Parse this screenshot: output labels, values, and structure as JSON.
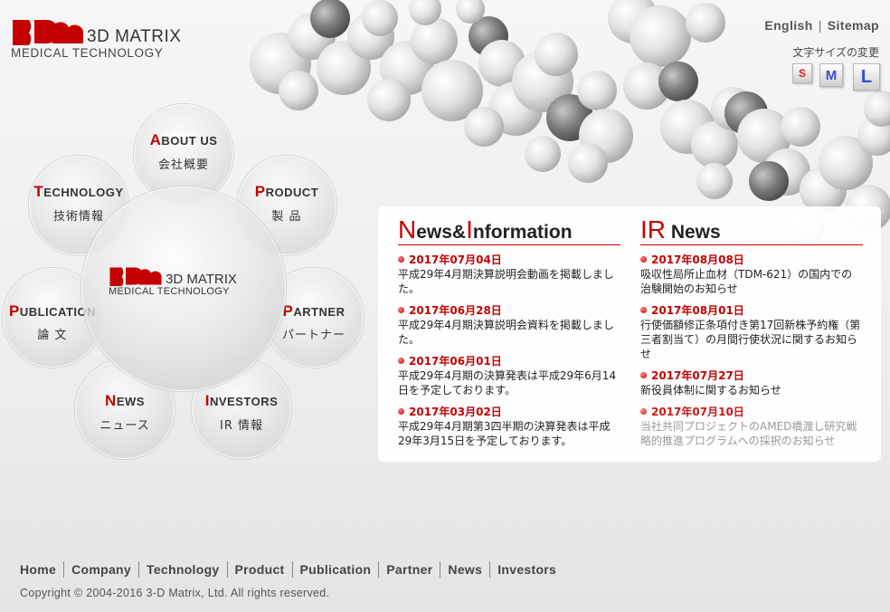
{
  "brand": {
    "name_line1": "3D MATRIX",
    "name_line2": "MEDICAL TECHNOLOGY",
    "accent_color": "#c40000"
  },
  "header": {
    "english": "English",
    "separator": "|",
    "sitemap": "Sitemap",
    "font_size_label": "文字サイズの変更",
    "font_sizes": [
      "S",
      "M",
      "L"
    ]
  },
  "circle_nav": {
    "about": {
      "cap": "A",
      "rest": "BOUT US",
      "jp": "会社概要"
    },
    "product": {
      "cap": "P",
      "rest": "RODUCT",
      "jp": "製 品"
    },
    "technology": {
      "cap": "T",
      "rest": "ECHNOLOGY",
      "jp": "技術情報"
    },
    "publication": {
      "cap": "P",
      "rest": "UBLICATION",
      "jp": "論 文"
    },
    "partner": {
      "cap": "P",
      "rest": "ARTNER",
      "jp": "パートナー"
    },
    "news": {
      "cap": "N",
      "rest": "EWS",
      "jp": "ニュース"
    },
    "investors": {
      "cap": "I",
      "rest": "NVESTORS",
      "jp": "IR 情報"
    }
  },
  "news": {
    "heading_cap1": "N",
    "heading_rest1": "ews&",
    "heading_cap2": "I",
    "heading_rest2": "nformation",
    "items": [
      {
        "date": "2017年07月04日",
        "text": "平成29年4月期決算説明会動画を掲載しました。"
      },
      {
        "date": "2017年06月28日",
        "text": "平成29年4月期決算説明会資料を掲載しました。"
      },
      {
        "date": "2017年06月01日",
        "text": "平成29年4月期の決算発表は平成29年6月14日を予定しております。"
      },
      {
        "date": "2017年03月02日",
        "text": "平成29年4月期第3四半期の決算発表は平成29年3月15日を予定しております。"
      }
    ]
  },
  "ir_news": {
    "heading_cap": "IR",
    "heading_rest": " News",
    "items": [
      {
        "date": "2017年08月08日",
        "text": "吸収性局所止血材（TDM-621）の国内での治験開始のお知らせ"
      },
      {
        "date": "2017年08月01日",
        "text": "行使価額修正条項付き第17回新株予約権（第三者割当て）の月間行使状況に関するお知らせ"
      },
      {
        "date": "2017年07月27日",
        "text": "新役員体制に関するお知らせ"
      },
      {
        "date": "2017年07月10日",
        "text": "当社共同プロジェクトのAMED橋渡し研究戦略的推進プログラムへの採択のお知らせ"
      }
    ]
  },
  "footer": {
    "nav": [
      "Home",
      "Company",
      "Technology",
      "Product",
      "Publication",
      "Partner",
      "News",
      "Investors"
    ],
    "copyright": "Copyright © 2004-2016 3-D Matrix, Ltd. All rights reserved."
  }
}
